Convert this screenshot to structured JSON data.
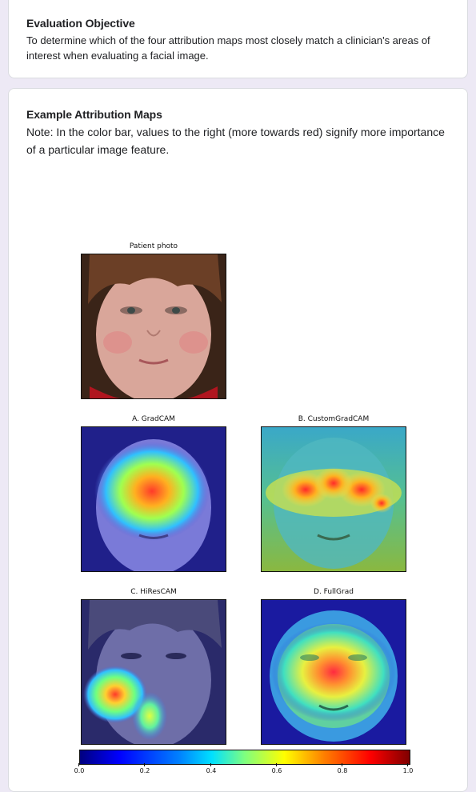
{
  "objective": {
    "title": "Evaluation Objective",
    "text": "To determine which of the four attribution maps most closely match a clinician's areas of interest when evaluating a facial image."
  },
  "examples": {
    "title": "Example Attribution Maps",
    "note": "Note: In the color bar, values to the right (more towards red) signify more importance of a particular image feature."
  },
  "figure": {
    "patient_label": "Patient photo",
    "panels": [
      {
        "label": "A. GradCAM"
      },
      {
        "label": "B. CustomGradCAM"
      },
      {
        "label": "C. HiResCAM"
      },
      {
        "label": "D. FullGrad"
      }
    ],
    "colorbar": {
      "ticks": [
        "0.0",
        "0.2",
        "0.4",
        "0.6",
        "0.8",
        "1.0"
      ],
      "colors": [
        "#00007f",
        "#0000ff",
        "#00ffff",
        "#ffff00",
        "#ff0000",
        "#7f0000"
      ]
    }
  }
}
